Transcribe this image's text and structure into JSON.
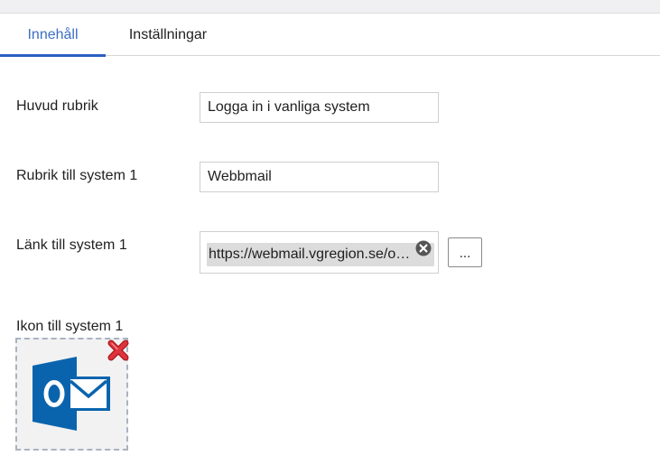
{
  "tabs": [
    {
      "label": "Innehåll",
      "active": true
    },
    {
      "label": "Inställningar",
      "active": false
    }
  ],
  "form": {
    "main_heading": {
      "label": "Huvud rubrik",
      "value": "Logga in i vanliga system"
    },
    "system1_heading": {
      "label": "Rubrik till system 1",
      "value": "Webbmail"
    },
    "system1_link": {
      "label": "Länk till system 1",
      "value": "https://webmail.vgregion.se/o…",
      "browse_label": "..."
    },
    "system1_icon": {
      "label": "Ikon till system 1",
      "image": "outlook-icon"
    }
  },
  "colors": {
    "accent": "#2a5fc2",
    "outlook_blue": "#0a64ad",
    "remove_red": "#e0343c"
  }
}
